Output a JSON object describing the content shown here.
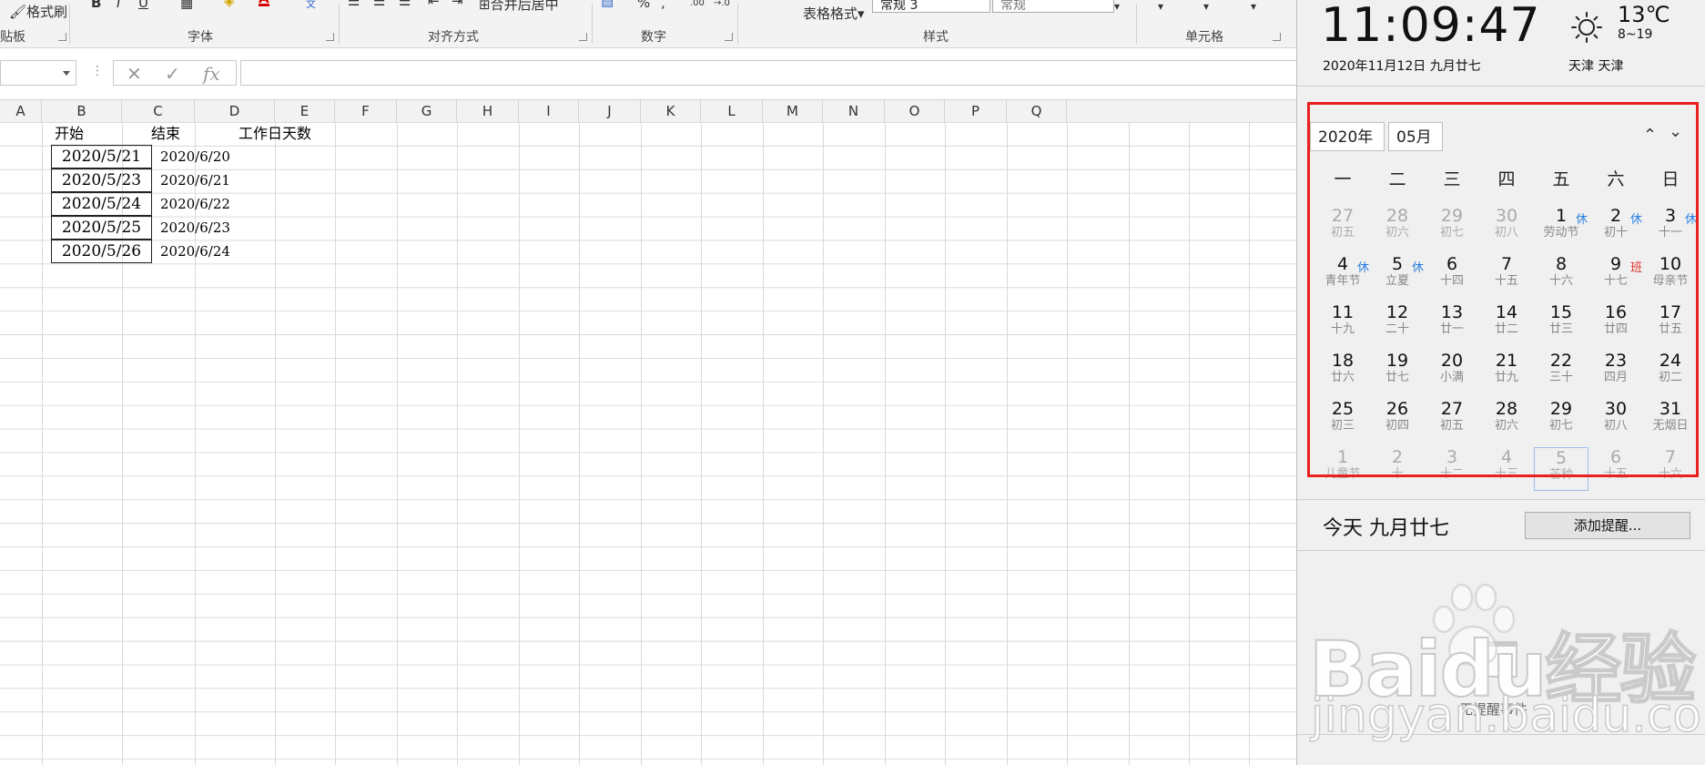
{
  "ribbon": {
    "clipboard": {
      "format_painter": "格式刷",
      "group": "贴板"
    },
    "font": {
      "group": "字体",
      "bold": "B",
      "italic": "I",
      "underline": "U",
      "font_color": "A"
    },
    "alignment": {
      "merge_center": "合并后居中",
      "group": "对齐方式"
    },
    "number": {
      "percent": "%",
      "group": "数字"
    },
    "styles": {
      "table_format": "表格格式",
      "style_box1": "常规 3",
      "style_box2": "常规",
      "group": "样式"
    },
    "cells": {
      "group": "单元格"
    }
  },
  "formula_bar": {
    "cancel_icon": "✕",
    "confirm_icon": "✓",
    "fx": "fx",
    "value": ""
  },
  "columns": [
    "A",
    "B",
    "C",
    "D",
    "E",
    "F",
    "G",
    "H",
    "I",
    "J",
    "K",
    "L",
    "M",
    "N",
    "O",
    "P",
    "Q"
  ],
  "sheet": {
    "header_b": "开始",
    "header_c": "结束",
    "header_d": "工作日天数",
    "rows": [
      {
        "start": "2020/5/21",
        "end": "2020/6/20"
      },
      {
        "start": "2020/5/23",
        "end": "2020/6/21"
      },
      {
        "start": "2020/5/24",
        "end": "2020/6/22"
      },
      {
        "start": "2020/5/25",
        "end": "2020/6/23"
      },
      {
        "start": "2020/5/26",
        "end": "2020/6/24"
      }
    ]
  },
  "panel": {
    "time": "11:09:47",
    "date": "2020年11月12日 九月廿七",
    "weather_icon": "sun-icon",
    "temperature": "13℃",
    "temp_range": "8~19",
    "city": "天津 天津",
    "year_select": "2020年",
    "month_select": "05月",
    "nav_up": "^",
    "nav_down": "v",
    "weekdays": [
      "一",
      "二",
      "三",
      "四",
      "五",
      "六",
      "日"
    ],
    "days": [
      {
        "n": "27",
        "l": "初五",
        "other": true
      },
      {
        "n": "28",
        "l": "初六",
        "other": true
      },
      {
        "n": "29",
        "l": "初七",
        "other": true
      },
      {
        "n": "30",
        "l": "初八",
        "other": true
      },
      {
        "n": "1",
        "l": "劳动节",
        "badge": "休"
      },
      {
        "n": "2",
        "l": "初十",
        "badge": "休"
      },
      {
        "n": "3",
        "l": "十一",
        "badge": "休"
      },
      {
        "n": "4",
        "l": "青年节",
        "badge": "休"
      },
      {
        "n": "5",
        "l": "立夏",
        "badge": "休"
      },
      {
        "n": "6",
        "l": "十四"
      },
      {
        "n": "7",
        "l": "十五"
      },
      {
        "n": "8",
        "l": "十六"
      },
      {
        "n": "9",
        "l": "十七",
        "badge": "班",
        "work": true
      },
      {
        "n": "10",
        "l": "母亲节"
      },
      {
        "n": "11",
        "l": "十九"
      },
      {
        "n": "12",
        "l": "二十"
      },
      {
        "n": "13",
        "l": "廿一"
      },
      {
        "n": "14",
        "l": "廿二"
      },
      {
        "n": "15",
        "l": "廿三"
      },
      {
        "n": "16",
        "l": "廿四"
      },
      {
        "n": "17",
        "l": "廿五"
      },
      {
        "n": "18",
        "l": "廿六"
      },
      {
        "n": "19",
        "l": "廿七"
      },
      {
        "n": "20",
        "l": "小满"
      },
      {
        "n": "21",
        "l": "廿九"
      },
      {
        "n": "22",
        "l": "三十"
      },
      {
        "n": "23",
        "l": "四月"
      },
      {
        "n": "24",
        "l": "初二"
      },
      {
        "n": "25",
        "l": "初三"
      },
      {
        "n": "26",
        "l": "初四"
      },
      {
        "n": "27",
        "l": "初五"
      },
      {
        "n": "28",
        "l": "初六"
      },
      {
        "n": "29",
        "l": "初七"
      },
      {
        "n": "30",
        "l": "初八"
      },
      {
        "n": "31",
        "l": "无烟日"
      },
      {
        "n": "1",
        "l": "儿童节",
        "other": true
      },
      {
        "n": "2",
        "l": "十",
        "other": true
      },
      {
        "n": "3",
        "l": "十二",
        "other": true
      },
      {
        "n": "4",
        "l": "十三",
        "other": true
      },
      {
        "n": "5",
        "l": "芒种",
        "other": true,
        "today": true
      },
      {
        "n": "6",
        "l": "十五",
        "other": true
      },
      {
        "n": "7",
        "l": "十六",
        "other": true
      }
    ],
    "today_label": "今天 九月廿七",
    "add_reminder": "添加提醒...",
    "no_events": "无提醒事件"
  },
  "watermark": {
    "main": "Baidu经验",
    "sub": "jingyan.baidu.com"
  },
  "colors": {
    "highlight": "#e8211e",
    "rest_badge": "#2a7fe0",
    "work_badge": "#e0302c"
  }
}
